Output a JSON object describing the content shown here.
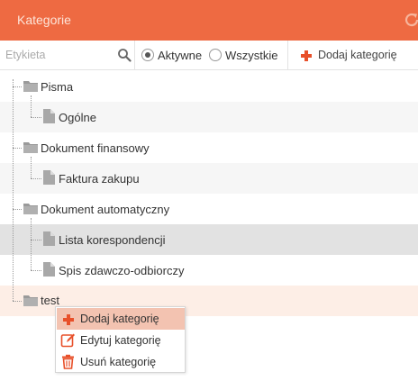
{
  "header": {
    "title": "Kategorie",
    "refresh_icon": "refresh-icon"
  },
  "toolbar": {
    "search_placeholder": "Etykieta",
    "search_icon": "search-icon",
    "radio_active": "Aktywne",
    "radio_all": "Wszystkie",
    "selected_filter": "Aktywne",
    "add_label": "Dodaj kategorię"
  },
  "tree": {
    "pisma": "Pisma",
    "ogolne": "Ogólne",
    "finansowy": "Dokument finansowy",
    "faktura": "Faktura zakupu",
    "automatyczny": "Dokument automatyczny",
    "lista": "Lista korespondencji",
    "spis": "Spis zdawczo-odbiorczy",
    "test": "test"
  },
  "context_menu": {
    "add": "Dodaj kategorię",
    "edit": "Edytuj kategorię",
    "delete": "Usuń kategorię"
  },
  "colors": {
    "accent": "#ee6a42",
    "icon_red": "#e8502a",
    "selected_row": "#e2e2e2",
    "active_row": "#fdeee6",
    "menu_highlight": "#f3c3b1"
  }
}
